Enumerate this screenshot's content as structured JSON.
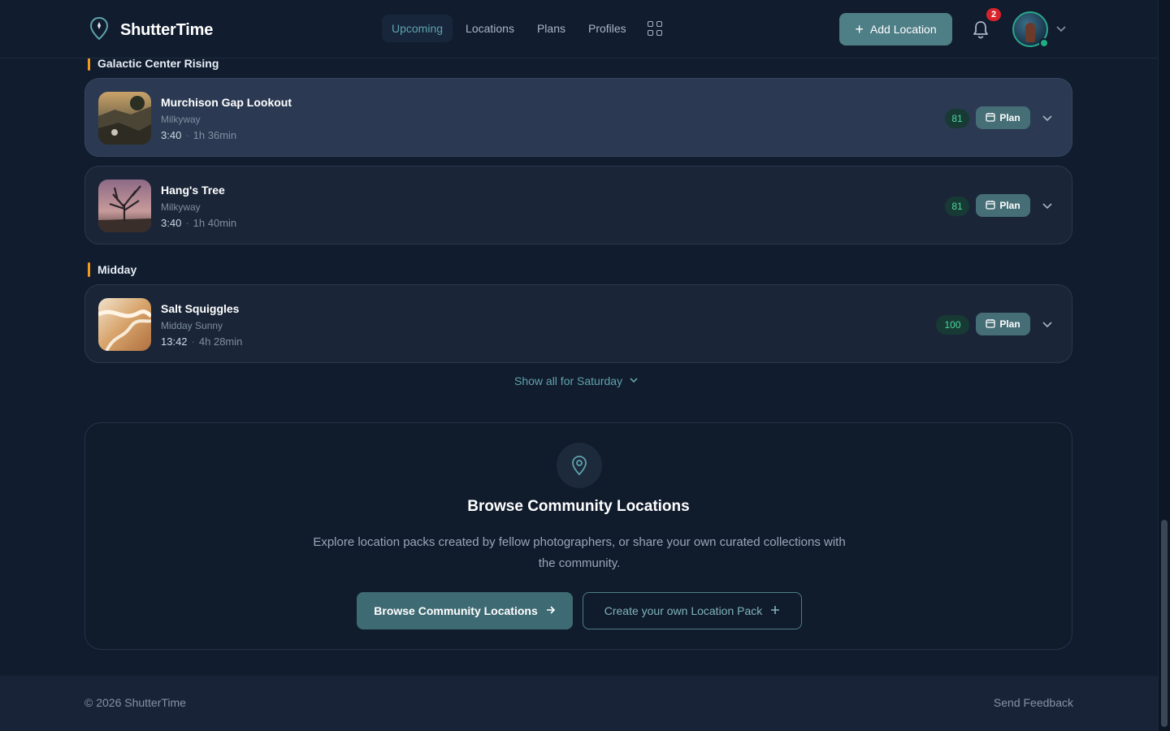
{
  "header": {
    "brand": "ShutterTime",
    "nav": [
      {
        "label": "Upcoming",
        "active": true
      },
      {
        "label": "Locations",
        "active": false
      },
      {
        "label": "Plans",
        "active": false
      },
      {
        "label": "Profiles",
        "active": false
      }
    ],
    "add_location_label": "Add Location",
    "notification_count": "2"
  },
  "sections": [
    {
      "label": "Galactic Center Rising",
      "items": [
        {
          "title": "Murchison Gap Lookout",
          "subtitle": "Milkyway",
          "time": "3:40",
          "duration": "1h 36min",
          "score": "81",
          "plan_label": "Plan"
        },
        {
          "title": "Hang's Tree",
          "subtitle": "Milkyway",
          "time": "3:40",
          "duration": "1h 40min",
          "score": "81",
          "plan_label": "Plan"
        }
      ]
    },
    {
      "label": "Midday",
      "items": [
        {
          "title": "Salt Squiggles",
          "subtitle": "Midday Sunny",
          "time": "13:42",
          "duration": "4h 28min",
          "score": "100",
          "plan_label": "Plan"
        }
      ]
    }
  ],
  "show_all_label": "Show all for Saturday",
  "community": {
    "title": "Browse Community Locations",
    "description": "Explore location packs created by fellow photographers, or share your own curated collections with the community.",
    "primary_button": "Browse Community Locations",
    "secondary_button": "Create your own Location Pack"
  },
  "footer": {
    "copyright": "© 2026 ShutterTime",
    "feedback": "Send Feedback"
  },
  "colors": {
    "background": "#111c2e",
    "accent": "#4e7e86",
    "section_marker": "#f29a1c",
    "score": "#4cd9a0",
    "badge": "#d8232a"
  }
}
